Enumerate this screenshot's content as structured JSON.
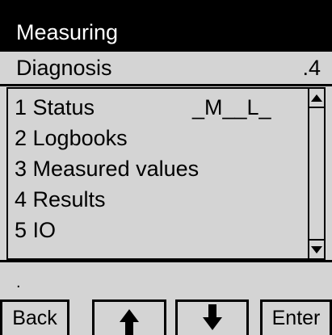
{
  "header": {
    "title": "Measuring"
  },
  "breadcrumb": {
    "label": "Diagnosis",
    "index": ".4"
  },
  "menu": {
    "items": [
      {
        "label": "1 Status",
        "status_code": "_M__L_"
      },
      {
        "label": "2 Logbooks"
      },
      {
        "label": "3 Measured values"
      },
      {
        "label": "4 Results"
      },
      {
        "label": "5 IO"
      }
    ]
  },
  "status_line": {
    "text": "."
  },
  "softkeys": {
    "back_label": "Back",
    "up_icon": "arrow-up-icon",
    "down_icon": "arrow-down-icon",
    "enter_label": "Enter"
  }
}
